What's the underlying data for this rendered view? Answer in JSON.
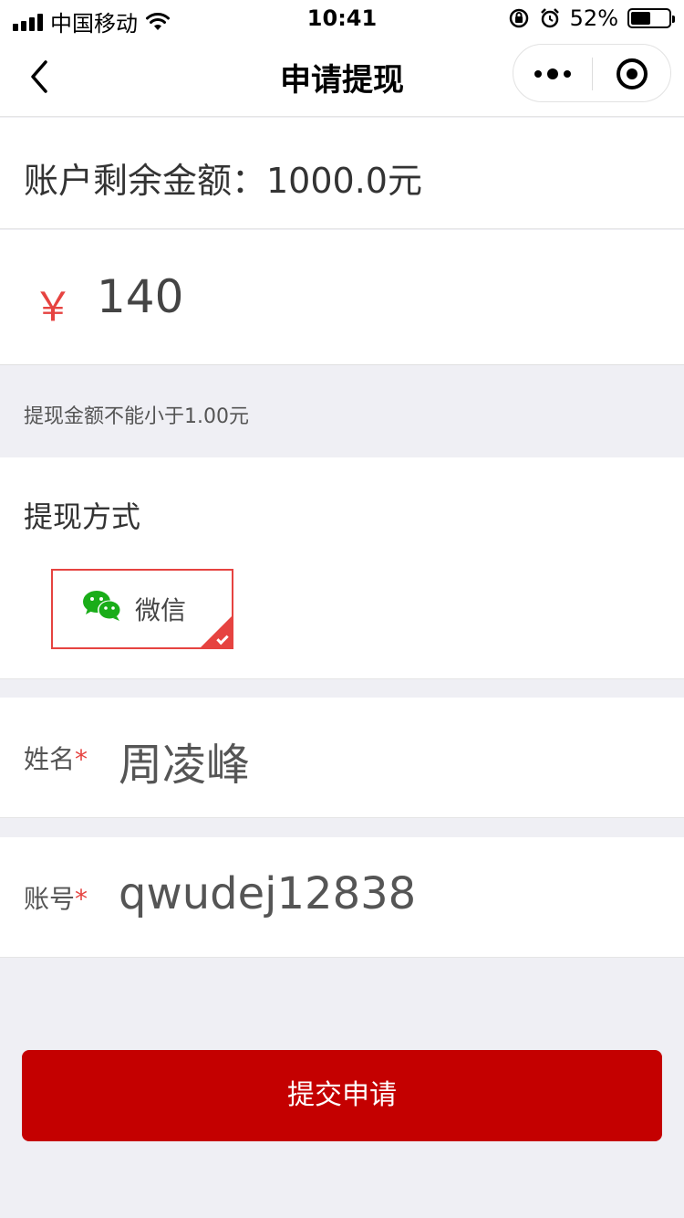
{
  "status_bar": {
    "carrier": "中国移动",
    "time": "10:41",
    "battery_percent": "52%",
    "battery_level": 0.52
  },
  "nav": {
    "title": "申请提现"
  },
  "balance": {
    "text": "账户剩余金额：1000.0元"
  },
  "amount": {
    "currency_symbol": "￥",
    "value": "140"
  },
  "hint": "提现金额不能小于1.00元",
  "method": {
    "title": "提现方式",
    "options": [
      {
        "label": "微信",
        "icon": "wechat-icon",
        "selected": true
      }
    ]
  },
  "form": {
    "name_label": "姓名",
    "name_value": "周凌峰",
    "account_label": "账号",
    "account_value": "qwudej12838",
    "required_mark": "*"
  },
  "submit_label": "提交申请",
  "colors": {
    "accent": "#c40000",
    "required": "#e64340",
    "wechat_green": "#1aad19"
  }
}
